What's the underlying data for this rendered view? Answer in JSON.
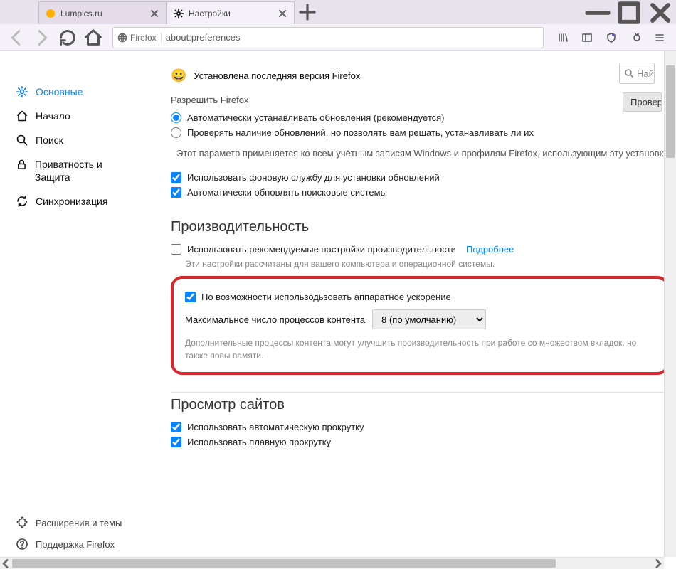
{
  "tabs": [
    {
      "title": "Lumpics.ru",
      "favicon_color": "#ffb000"
    },
    {
      "title": "Настройки",
      "active": true
    }
  ],
  "url": {
    "identity_label": "Firefox",
    "value": "about:preferences"
  },
  "sidebar": {
    "items": [
      {
        "key": "general",
        "label": "Основные",
        "icon": "gear",
        "active": true
      },
      {
        "key": "home",
        "label": "Начало",
        "icon": "home"
      },
      {
        "key": "search",
        "label": "Поиск",
        "icon": "search"
      },
      {
        "key": "privacy",
        "label": "Приватность и Защита",
        "icon": "lock"
      },
      {
        "key": "sync",
        "label": "Синхронизация",
        "icon": "sync"
      }
    ],
    "bottom": [
      {
        "key": "extensions",
        "label": "Расширения и темы",
        "icon": "puzzle"
      },
      {
        "key": "support",
        "label": "Поддержка Firefox",
        "icon": "help"
      }
    ]
  },
  "search_placeholder": "Най",
  "update": {
    "status": "Установлена последняя версия Firefox",
    "check_button": "Провер",
    "allow_label": "Разрешить Firefox",
    "radio_auto": "Автоматически устанавливать обновления (рекомендуется)",
    "radio_manual": "Проверять наличие обновлений, но позволять вам решать, устанавливать ли их",
    "info": "Этот параметр применяется ко всем учётным записям Windows и профилям Firefox, использующим эту установку",
    "bg_service": "Использовать фоновую службу для установки обновлений",
    "auto_search": "Автоматически обновлять поисковые системы"
  },
  "perf": {
    "title": "Производительность",
    "use_recommended": "Использовать рекомендуемые настройки производительности",
    "learn_more": "Подробнее",
    "recommended_desc": "Эти настройки рассчитаны для вашего компьютера и операционной системы.",
    "hw_accel": "По возможности использодьзовать аппаратное ускорение",
    "process_label": "Максимальное число процессов контента",
    "process_value": "8 (по умолчанию)",
    "process_desc": "Дополнительные процессы контента могут улучшить производительность при работе со множеством вкладок, но также повы памяти."
  },
  "browsing": {
    "title": "Просмотр сайтов",
    "autoscroll": "Использовать автоматическую прокрутку",
    "smoothscroll": "Использовать плавную прокрутку"
  }
}
